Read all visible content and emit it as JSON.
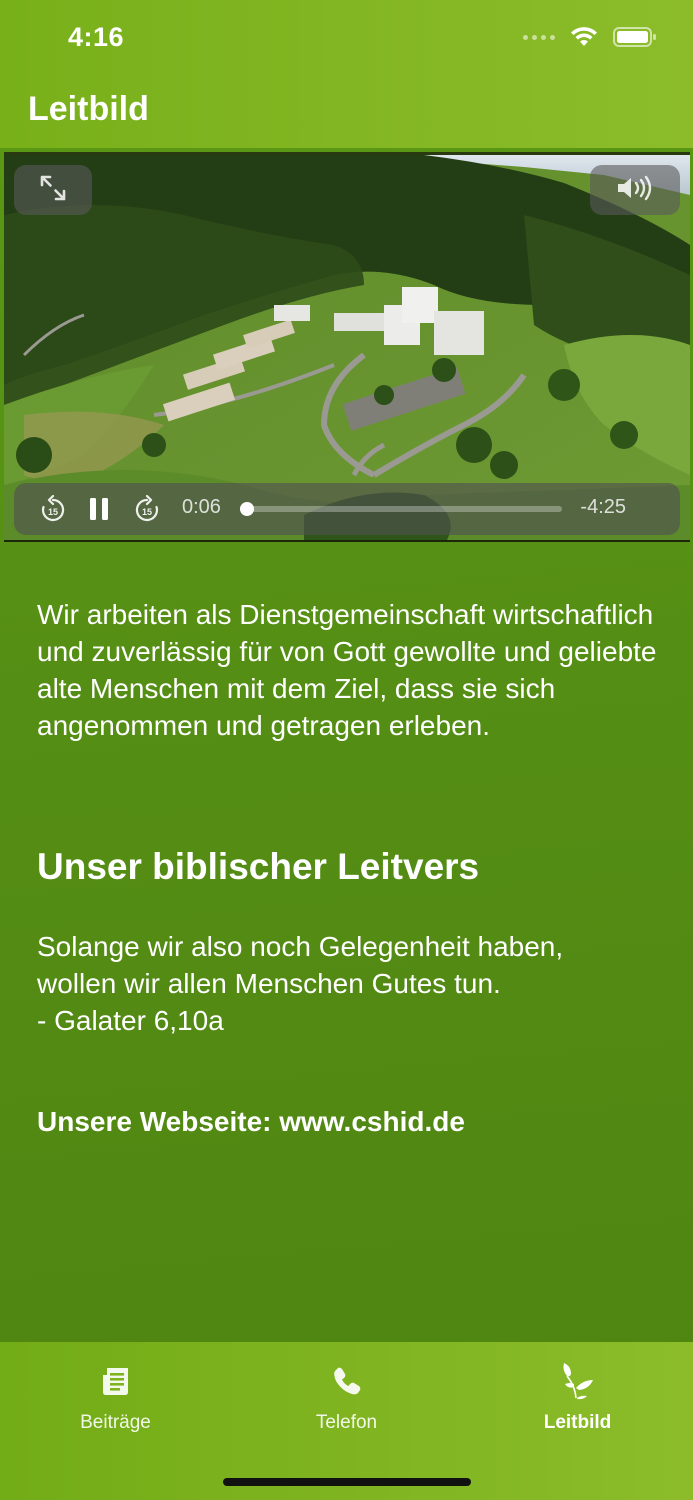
{
  "status_bar": {
    "time": "4:16"
  },
  "header": {
    "title": "Leitbild"
  },
  "video": {
    "current_time": "0:06",
    "remaining_time": "-4:25",
    "progress": 0.023,
    "controls": {
      "expand_icon": "expand-arrows-icon",
      "volume_icon": "speaker-volume-icon",
      "rewind_icon": "skip-back-15-icon",
      "pause_icon": "pause-icon",
      "forward_icon": "skip-forward-15-icon"
    },
    "skip_seconds": "15"
  },
  "content": {
    "intro": "Wir arbeiten als Dienstgemeinschaft wirtschaftlich und zuverlässig für von Gott gewollte und geliebte alte Menschen mit dem Ziel, dass sie sich angenommen und getragen erleben.",
    "heading": "Unser biblischer Leitvers",
    "verse_line1": "Solange wir also noch Gelegenheit haben,",
    "verse_line2": "wollen wir allen Menschen Gutes tun.",
    "verse_source": "- Galater 6,10a",
    "website": "Unsere Webseite: www.cshid.de"
  },
  "tabbar": {
    "tabs": [
      {
        "label": "Beiträge",
        "icon": "newspaper-icon",
        "active": false
      },
      {
        "label": "Telefon",
        "icon": "phone-icon",
        "active": false
      },
      {
        "label": "Leitbild",
        "icon": "leaves-icon",
        "active": true
      }
    ]
  },
  "colors": {
    "header": "#8cbc2a",
    "background": "#558e14",
    "tabbar": "#7fb420"
  }
}
